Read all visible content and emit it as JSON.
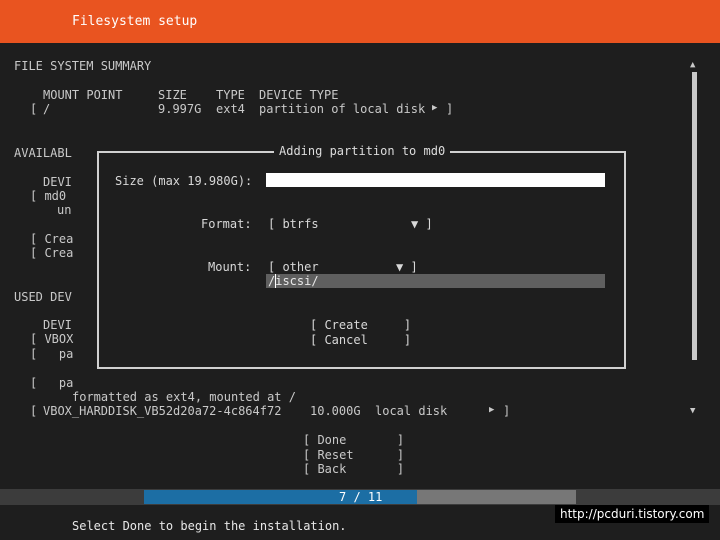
{
  "header": {
    "title": "Filesystem setup"
  },
  "summary": {
    "heading": "FILE SYSTEM SUMMARY",
    "columns": [
      "MOUNT POINT",
      "SIZE",
      "TYPE",
      "DEVICE TYPE"
    ],
    "row": {
      "open": "[",
      "mount": "/",
      "size": "9.997G",
      "type": "ext4",
      "device": "partition of local disk",
      "arrow": "▶",
      "close": "]"
    }
  },
  "available": {
    "heading": "AVAILABL",
    "col": "DEVI",
    "device": "[ md0",
    "sub": "un",
    "create1": "[ Crea",
    "create2": "[ Crea"
  },
  "used": {
    "heading": "USED DEV",
    "col": "DEVI",
    "device": "[ VBOX",
    "part1": "[   pa",
    "part2": "[   pa",
    "formatted": "formatted as ext4, mounted at /",
    "disk": {
      "open": "[",
      "name": "VBOX_HARDDISK_VB52d20a72-4c864f72",
      "size": "10.000G",
      "type": "local disk",
      "arrow": "▶",
      "close": "]"
    }
  },
  "dialog": {
    "title": "Adding partition to md0",
    "size_label": "Size (max 19.980G):",
    "size_value": "",
    "format_label": "Format:",
    "format_value": "[ btrfs",
    "format_arrow": "▼ ]",
    "mount_label": "Mount:",
    "mount_value": "[ other",
    "mount_arrow": "▼ ]",
    "mount_path": "/iscsi/",
    "create_button": "[ Create     ]",
    "cancel_button": "[ Cancel     ]"
  },
  "actions": {
    "done": "[ Done       ]",
    "reset": "[ Reset      ]",
    "back": "[ Back       ]"
  },
  "progress": {
    "label": "7 / 11",
    "current": 7,
    "total": 11
  },
  "status": "Select Done to begin the installation.",
  "watermark": "http://pcduri.tistory.com",
  "scrollbar": {
    "up": "▲",
    "down": "▼"
  },
  "colors": {
    "header": "#e95420",
    "progress": "#1c6ea4",
    "background": "#1e1e1e"
  }
}
